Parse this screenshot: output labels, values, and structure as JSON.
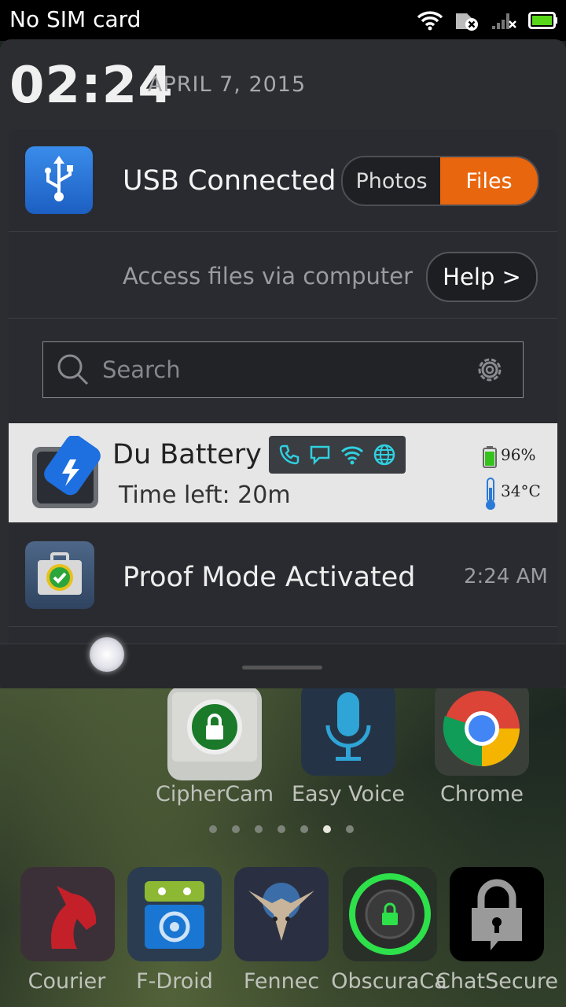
{
  "status_bar": {
    "carrier": "No SIM card",
    "icons": [
      "wifi-icon",
      "sim-error-icon",
      "signal-no-service-icon",
      "battery-icon"
    ]
  },
  "shade": {
    "time": "02:24",
    "date": "APRIL 7, 2015"
  },
  "usb": {
    "title": "USB Connected",
    "options": [
      "Photos",
      "Files"
    ],
    "selected": "Files",
    "description": "Access files via computer",
    "help_label": "Help >"
  },
  "search": {
    "placeholder": "Search"
  },
  "du_battery": {
    "title": "Du Battery",
    "time_left": "Time left: 20m",
    "battery_pct": "96%",
    "temperature": "34°C",
    "toggles": [
      "phone-icon",
      "message-icon",
      "wifi-icon",
      "globe-icon"
    ]
  },
  "proof_mode": {
    "title": "Proof Mode Activated",
    "time": "2:24 AM"
  },
  "home": {
    "row1": [
      {
        "label": "CipherCam"
      },
      {
        "label": "Easy Voice"
      },
      {
        "label": "Chrome"
      }
    ],
    "page_dots": {
      "count": 7,
      "active": 6
    },
    "dock": [
      {
        "label": "Courier"
      },
      {
        "label": "F-Droid"
      },
      {
        "label": "Fennec"
      },
      {
        "label": "ObscuraCa"
      },
      {
        "label": "ChatSecure"
      }
    ]
  },
  "colors": {
    "accent": "#e8660e",
    "usb_blue": "#2a76dc",
    "toggle_cyan": "#2fd0e0"
  }
}
